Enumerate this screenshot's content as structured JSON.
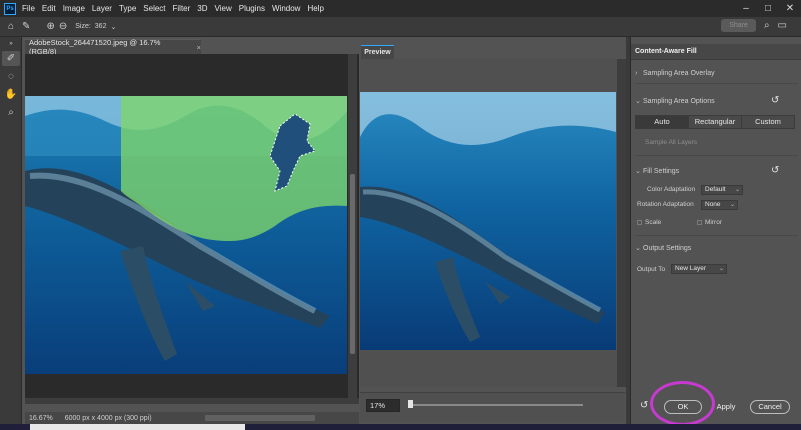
{
  "app": {
    "logo": "Ps"
  },
  "menubar": {
    "items": [
      "File",
      "Edit",
      "Image",
      "Layer",
      "Type",
      "Select",
      "Filter",
      "3D",
      "View",
      "Plugins",
      "Window",
      "Help"
    ],
    "controls": [
      "–",
      "□",
      "✕"
    ]
  },
  "options": {
    "size_label": "Size:",
    "size_value": "362",
    "share_label": "Share"
  },
  "document": {
    "tab_title": "AdobeStock_264471520.jpeg @ 16.7% (RGB/8)",
    "close": "×",
    "status_zoom": "16.67%",
    "status_size": "6000 px x 4000 px (300 ppi)"
  },
  "preview": {
    "tab_label": "Preview",
    "zoom_value": "17%"
  },
  "caf": {
    "title": "Content-Aware Fill",
    "sections": {
      "sampling_overlay": "Sampling Area Overlay",
      "sampling_options": "Sampling Area Options",
      "fill_settings": "Fill Settings",
      "output_settings": "Output Settings"
    },
    "segments": [
      "Auto",
      "Rectangular",
      "Custom"
    ],
    "active_segment": "Auto",
    "sample_all_layers": "Sample All Layers",
    "color_adaptation_label": "Color Adaptation",
    "color_adaptation_value": "Default",
    "rotation_adaptation_label": "Rotation Adaptation",
    "rotation_adaptation_value": "None",
    "scale_label": "Scale",
    "mirror_label": "Mirror",
    "output_to_label": "Output To",
    "output_to_value": "New Layer",
    "buttons": {
      "ok": "OK",
      "apply": "Apply",
      "cancel": "Cancel"
    }
  },
  "colors": {
    "highlight_circle": "#c63ad0",
    "accent": "#31a8ff",
    "sampling_overlay": "#7fd66a"
  }
}
